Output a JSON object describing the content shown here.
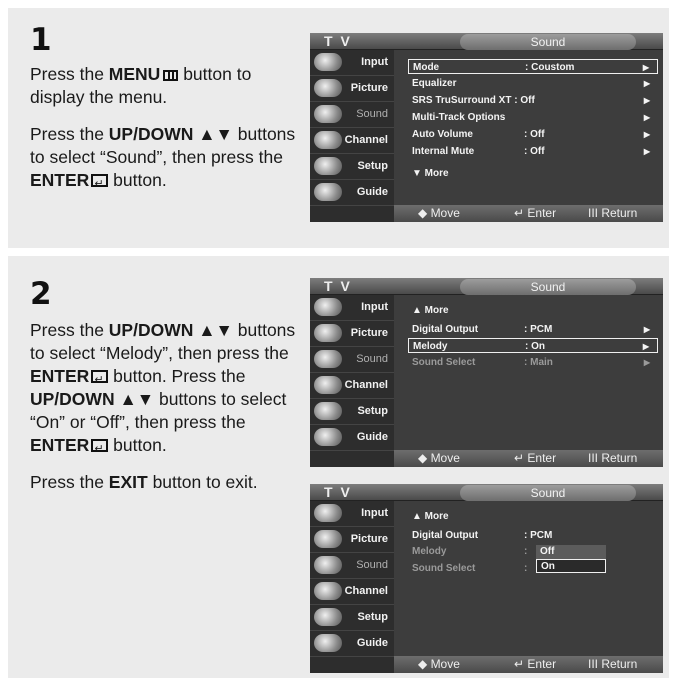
{
  "step1": {
    "number": "1",
    "p1": [
      "Press the ",
      "MENU",
      " button to display the menu."
    ],
    "p2": [
      "Press the ",
      "UP/DOWN ▲▼",
      " buttons to select “Sound”, then press the ",
      "ENTER",
      " button."
    ]
  },
  "step2": {
    "number": "2",
    "p1": [
      "Press the ",
      "UP/DOWN ▲▼",
      " buttons to select “Melody”, then press the ",
      "ENTER",
      " button. Press the ",
      "UP/DOWN ▲▼",
      " buttons to select “On” or “Off”, then press the ",
      "ENTER",
      " button."
    ],
    "p2": [
      "Press the ",
      "EXIT",
      " button to exit."
    ]
  },
  "osd_common": {
    "tv_label": "T V",
    "title": "Sound",
    "side_items": [
      "Input",
      "Picture",
      "Sound",
      "Channel",
      "Setup",
      "Guide"
    ],
    "footer_move": "◆ Move",
    "footer_enter": "↵ Enter",
    "footer_return": "III Return"
  },
  "osd1": {
    "rows": [
      {
        "label": "Mode",
        "value": ": Coustom",
        "arrow": "▶"
      },
      {
        "label": "Equalizer",
        "value": "",
        "arrow": "▶"
      },
      {
        "label": "SRS TruSurround XT : Off",
        "value": "",
        "arrow": "▶"
      },
      {
        "label": "Multi-Track Options",
        "value": "",
        "arrow": "▶"
      },
      {
        "label": "Auto Volume",
        "value": ": Off",
        "arrow": "▶"
      },
      {
        "label": "Internal Mute",
        "value": ": Off",
        "arrow": "▶"
      }
    ],
    "more": "▼ More"
  },
  "osd2": {
    "more": "▲ More",
    "rows": [
      {
        "label": "Digital Output",
        "value": ": PCM",
        "arrow": "▶"
      },
      {
        "label": "Melody",
        "value": ": On",
        "arrow": "▶"
      },
      {
        "label": "Sound Select",
        "value": ": Main",
        "arrow": "▶"
      }
    ]
  },
  "osd3": {
    "more": "▲ More",
    "rows": [
      {
        "label": "Digital Output",
        "value": ": PCM"
      },
      {
        "label": "Melody",
        "value": ":"
      },
      {
        "label": "Sound Select",
        "value": ":"
      }
    ],
    "options": [
      "Off",
      "On"
    ]
  }
}
